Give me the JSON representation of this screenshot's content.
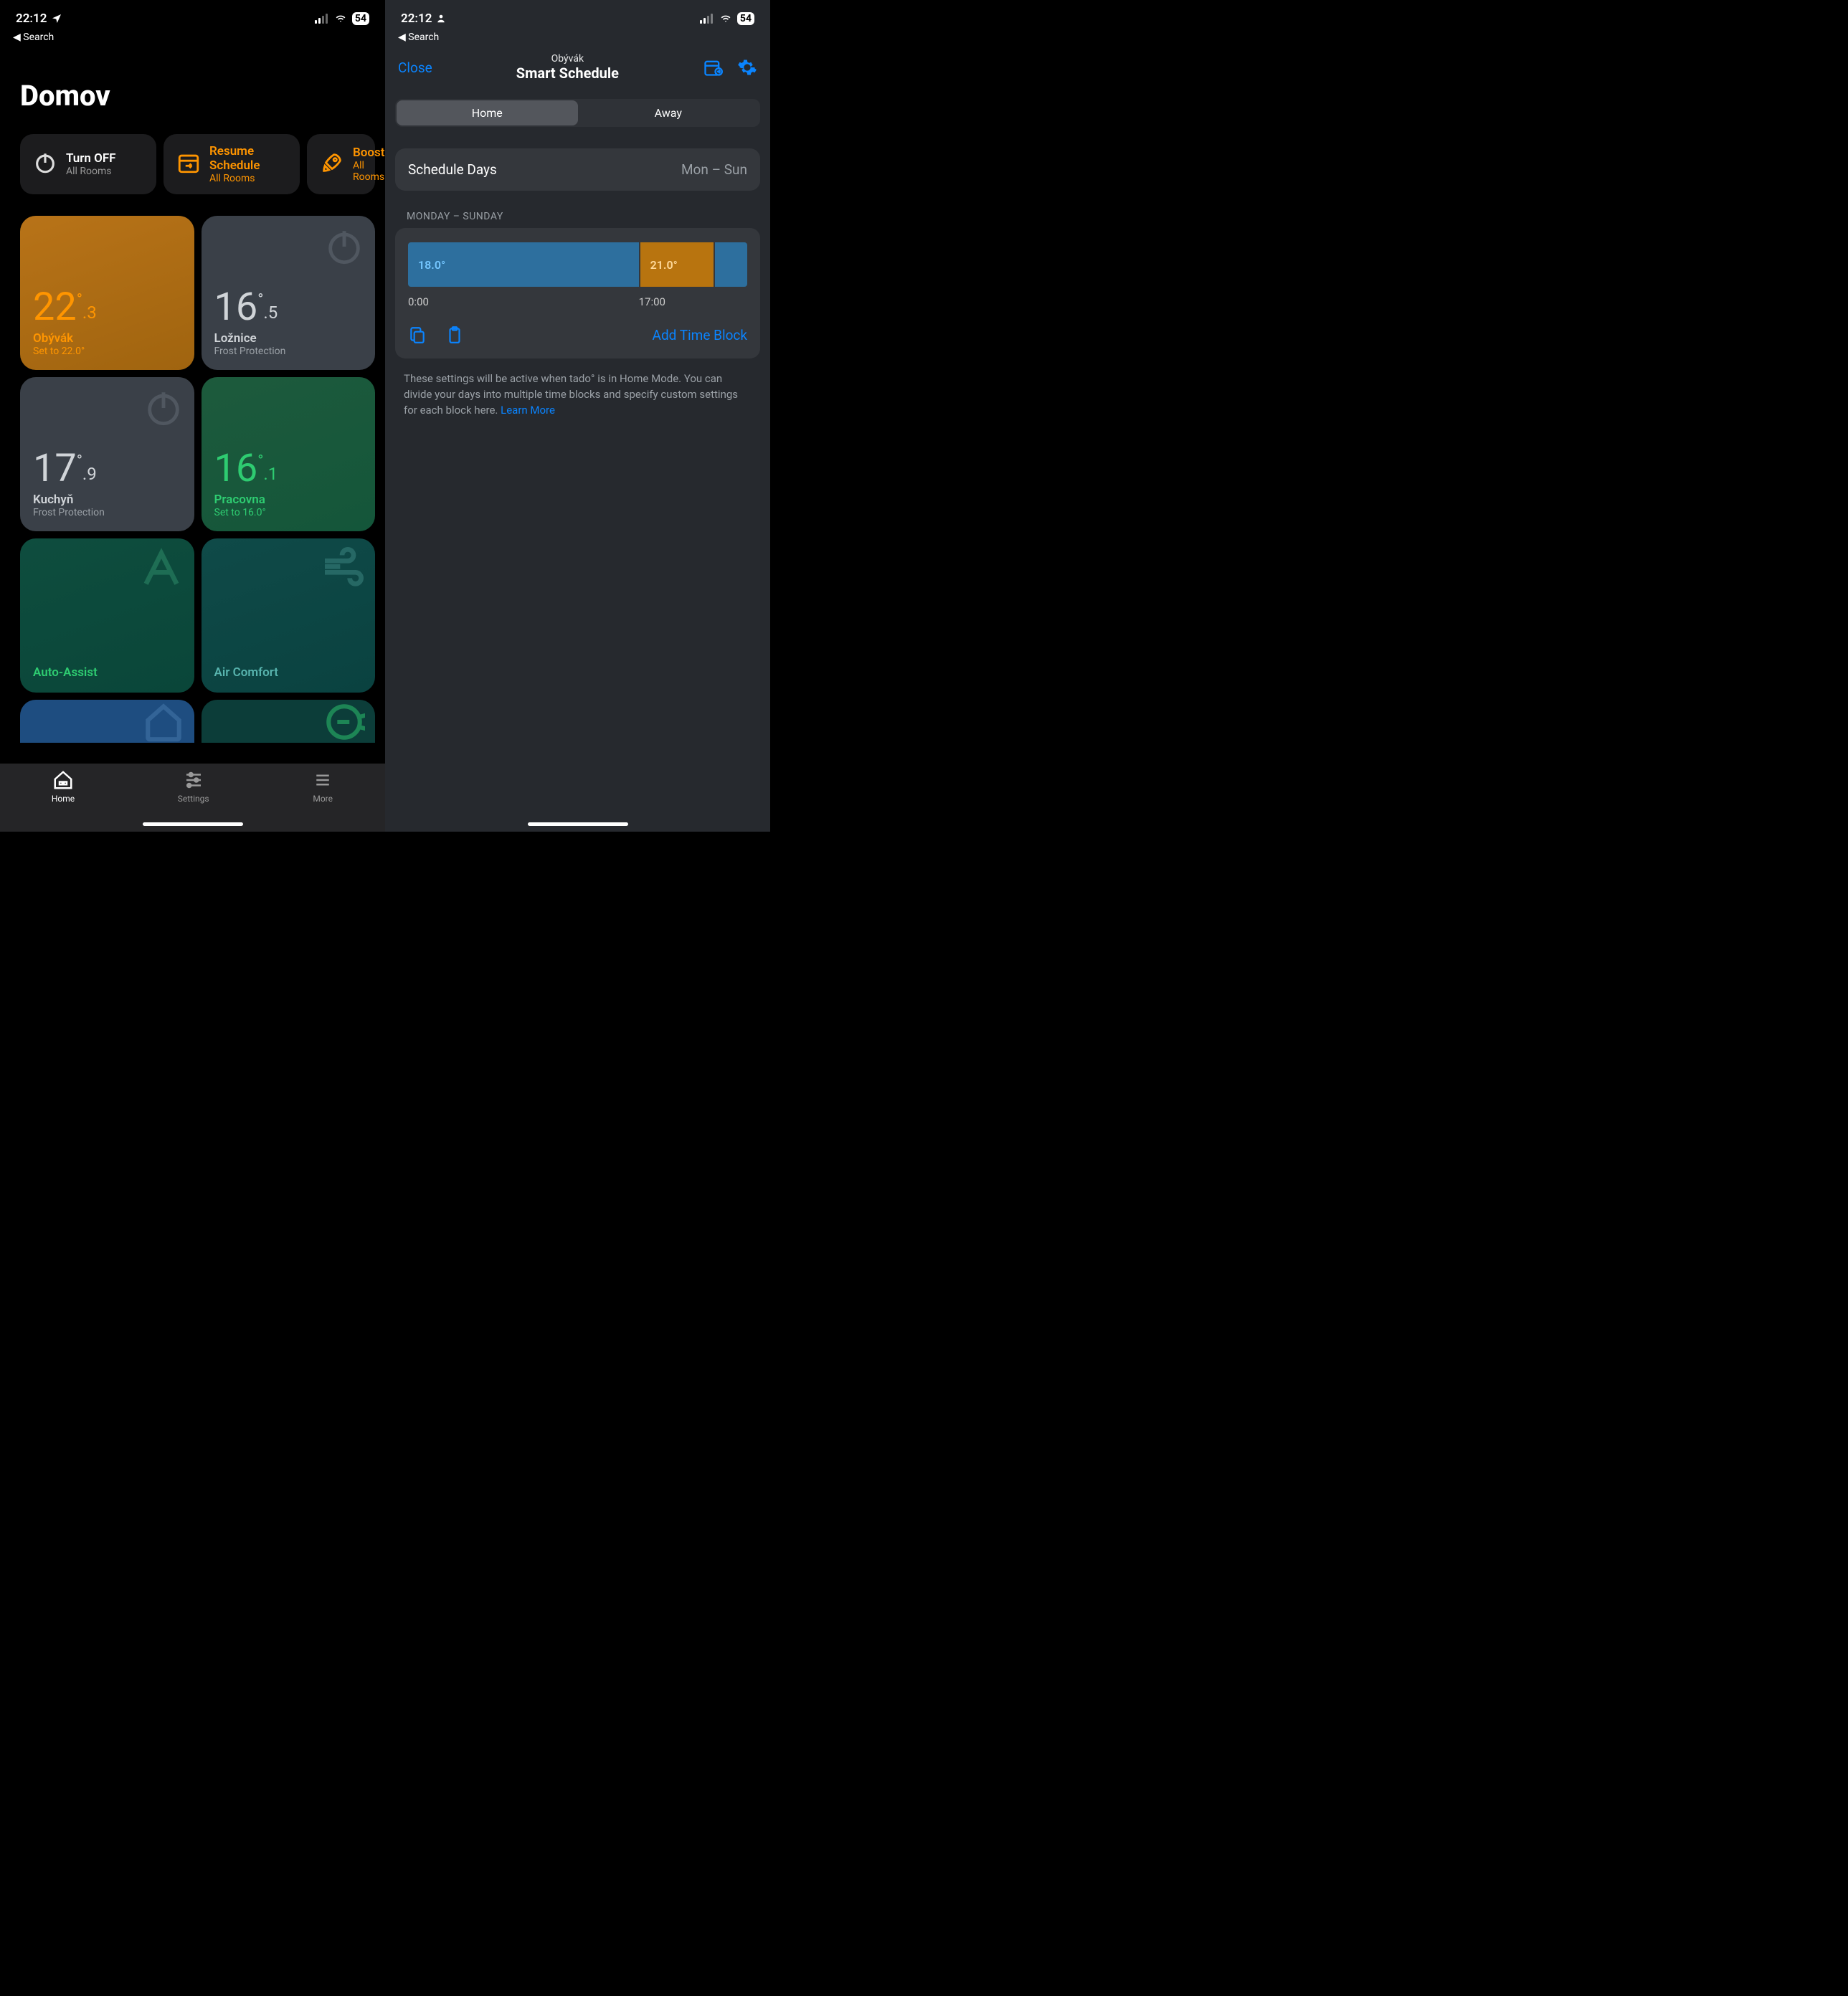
{
  "left": {
    "status": {
      "time": "22:12",
      "battery": "54",
      "back": "Search"
    },
    "title": "Domov",
    "actions": [
      {
        "title": "Turn OFF",
        "sub": "All Rooms",
        "icon": "power-icon",
        "accent": false
      },
      {
        "title": "Resume Schedule",
        "sub": "All Rooms",
        "icon": "calendar-arrow-icon",
        "accent": true
      },
      {
        "title": "Boost",
        "sub": "All Rooms",
        "icon": "rocket-icon",
        "accent": true
      }
    ],
    "tiles": [
      {
        "tempWhole": "22",
        "tempFrac": ".3",
        "name": "Obývák",
        "sub": "Set to 22.0°",
        "style": "orange",
        "power": false
      },
      {
        "tempWhole": "16",
        "tempFrac": ".5",
        "name": "Ložnice",
        "sub": "Frost Protection",
        "style": "gray",
        "power": true
      },
      {
        "tempWhole": "17",
        "tempFrac": ".9",
        "name": "Kuchyň",
        "sub": "Frost Protection",
        "style": "gray",
        "power": true
      },
      {
        "tempWhole": "16",
        "tempFrac": ".1",
        "name": "Pracovna",
        "sub": "Set to 16.0°",
        "style": "green",
        "power": false
      }
    ],
    "featureTiles": [
      {
        "label": "Auto-Assist",
        "style": "teal-a",
        "icon": "letter-a-icon"
      },
      {
        "label": "Air Comfort",
        "style": "teal-b",
        "icon": "wind-icon"
      }
    ],
    "partialIcons": {
      "left": "house-icon",
      "right": "eco-e-icon"
    },
    "tabs": [
      {
        "label": "Home",
        "active": true
      },
      {
        "label": "Settings",
        "active": false
      },
      {
        "label": "More",
        "active": false
      }
    ]
  },
  "right": {
    "status": {
      "time": "22:12",
      "battery": "54",
      "back": "Search"
    },
    "nav": {
      "close": "Close",
      "subtitle": "Obývák",
      "title": "Smart Schedule"
    },
    "segments": [
      "Home",
      "Away"
    ],
    "activeSegment": "Home",
    "scheduleDays": {
      "label": "Schedule Days",
      "value": "Mon – Sun"
    },
    "sectionHeader": "MONDAY – SUNDAY",
    "timeline": {
      "blocks": [
        {
          "temp": "18.0°",
          "color": "blue"
        },
        {
          "temp": "21.0°",
          "color": "orange"
        }
      ],
      "ticks": [
        "0:00",
        "17:00"
      ]
    },
    "addTimeBlock": "Add Time Block",
    "footnote": "These settings will be active when tado° is in Home Mode. You can divide your days into multiple time blocks and specify custom settings for each block here. ",
    "learnMore": "Learn More"
  }
}
